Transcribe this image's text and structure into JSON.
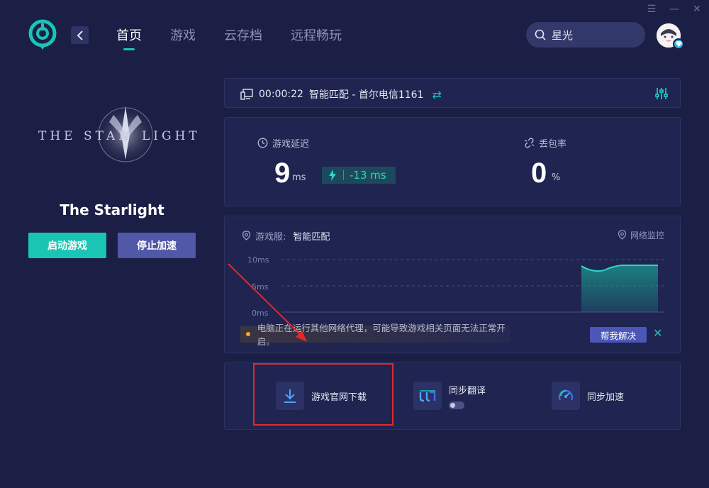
{
  "header": {
    "nav_tabs": [
      {
        "label": "首页",
        "active": true
      },
      {
        "label": "游戏",
        "active": false
      },
      {
        "label": "云存档",
        "active": false
      },
      {
        "label": "远程畅玩",
        "active": false
      }
    ],
    "search_value": "星光"
  },
  "game": {
    "name": "The Starlight",
    "start_label": "启动游戏",
    "stop_label": "停止加速"
  },
  "connection": {
    "elapsed": "00:00:22",
    "route": "智能匹配 - 首尔电信1161"
  },
  "stats": {
    "latency_label": "游戏延迟",
    "latency_value": "9",
    "latency_unit": "ms",
    "latency_delta": "-13 ms",
    "loss_label": "丢包率",
    "loss_value": "0",
    "loss_unit": "%"
  },
  "server": {
    "label": "游戏服:",
    "value": "智能匹配",
    "monitor_label": "网络监控",
    "y_ticks": [
      "10ms",
      "5ms",
      "0ms"
    ]
  },
  "warning": {
    "text": "电脑正在运行其他网络代理，可能导致游戏相关页面无法正常开启。",
    "help_label": "帮我解决"
  },
  "tools": {
    "download_label": "游戏官网下载",
    "translate_label": "同步翻译",
    "sync_accel_label": "同步加速"
  },
  "colors": {
    "accent": "#19c5b5",
    "background": "#1b1f45",
    "card": "#1f2450",
    "stop_button": "#5158a8",
    "annotation": "#e02a2a"
  }
}
